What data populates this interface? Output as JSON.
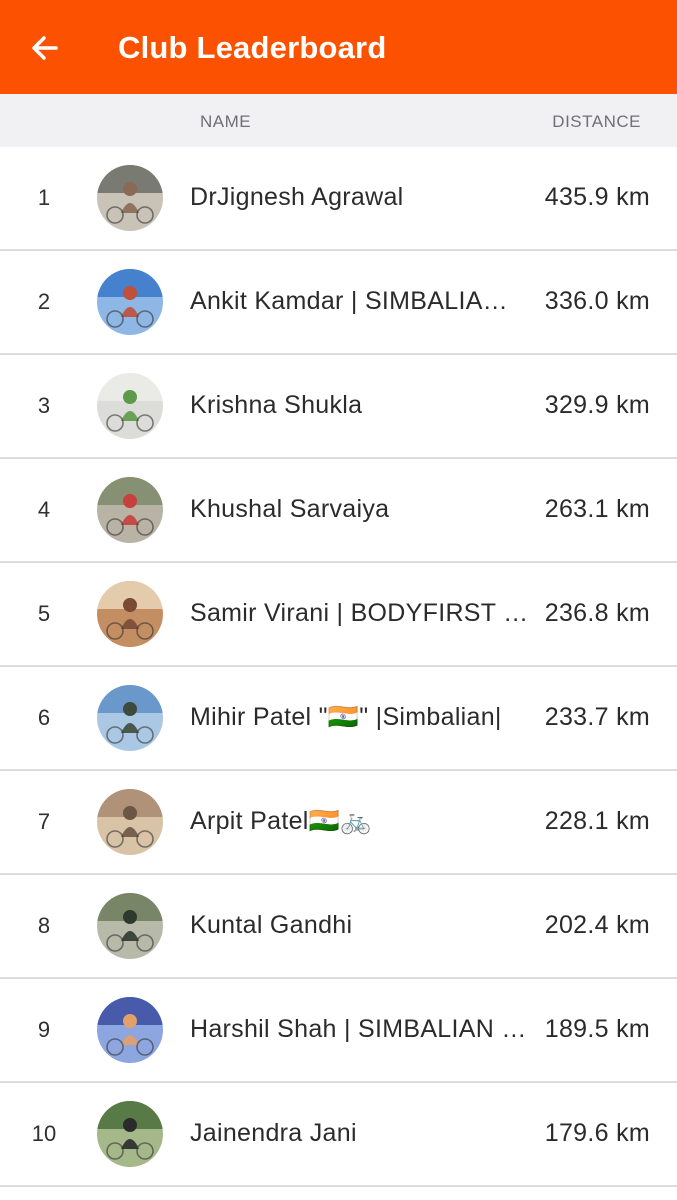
{
  "header": {
    "title": "Club Leaderboard",
    "background_color": "#fc5200",
    "back_icon": "arrow-left-icon"
  },
  "columns": {
    "name": "NAME",
    "distance": "DISTANCE"
  },
  "entries": [
    {
      "rank": "1",
      "name": "DrJignesh Agrawal",
      "distance": "435.9 km",
      "avatar_colors": [
        "#6b6f66",
        "#c9c2b6",
        "#8a6a52"
      ]
    },
    {
      "rank": "2",
      "name": "Ankit Kamdar | SIMBALIA…",
      "distance": "336.0 km",
      "avatar_colors": [
        "#3a78c8",
        "#8fb7e6",
        "#c0503a"
      ]
    },
    {
      "rank": "3",
      "name": "Krishna Shukla",
      "distance": "329.9 km",
      "avatar_colors": [
        "#ececea",
        "#dcdcd8",
        "#5d9a4a"
      ]
    },
    {
      "rank": "4",
      "name": "Khushal Sarvaiya",
      "distance": "263.1 km",
      "avatar_colors": [
        "#7c8a6a",
        "#b9b3a6",
        "#c7403c"
      ]
    },
    {
      "rank": "5",
      "name": "Samir Virani | BODYFIRST …",
      "distance": "236.8 km",
      "avatar_colors": [
        "#e9d6b8",
        "#c48e63",
        "#7a4a37"
      ]
    },
    {
      "rank": "6",
      "name": "Mihir Patel \"🇮🇳\" |Simbalian|",
      "distance": "233.7 km",
      "avatar_colors": [
        "#5f8fc6",
        "#aac7e4",
        "#3e4a3c"
      ]
    },
    {
      "rank": "7",
      "name": "Arpit Patel🇮🇳🚲",
      "distance": "228.1 km",
      "avatar_colors": [
        "#a88a6e",
        "#d8c3a6",
        "#6b5744"
      ]
    },
    {
      "rank": "8",
      "name": "Kuntal Gandhi",
      "distance": "202.4 km",
      "avatar_colors": [
        "#6d7c5c",
        "#b7b9a9",
        "#2f3a2e"
      ]
    },
    {
      "rank": "9",
      "name": "Harshil Shah | SIMBALIAN …",
      "distance": "189.5 km",
      "avatar_colors": [
        "#3c4ea0",
        "#8ea6e0",
        "#e2a06a"
      ]
    },
    {
      "rank": "10",
      "name": "Jainendra Jani",
      "distance": "179.6 km",
      "avatar_colors": [
        "#4a6e3a",
        "#a5b88a",
        "#2b2b2b"
      ]
    }
  ]
}
